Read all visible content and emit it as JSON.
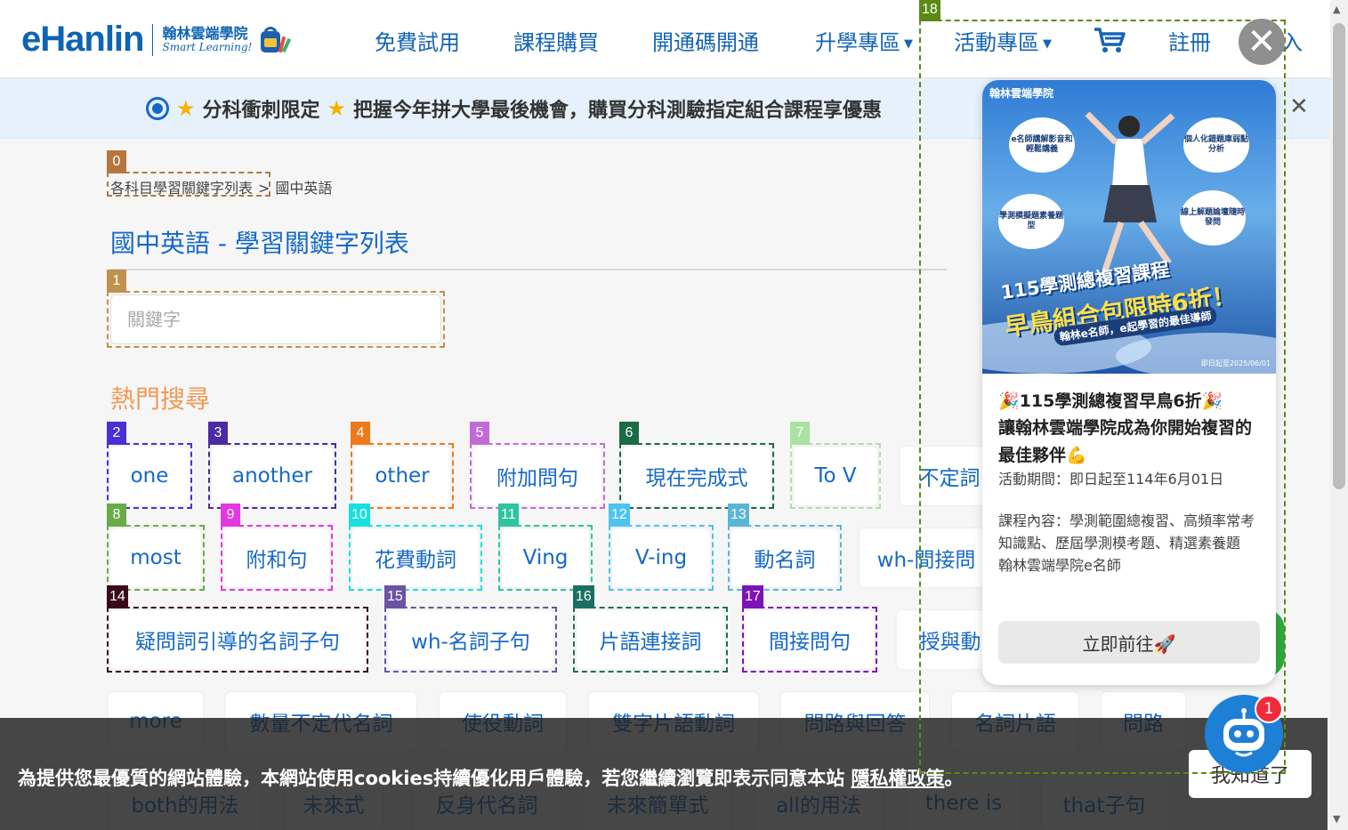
{
  "header": {
    "logo_text": "eHanlin",
    "logo_zh": "翰林雲端學院",
    "logo_en": "Smart Learning!",
    "nav": [
      {
        "label": "免費試用",
        "dropdown": false
      },
      {
        "label": "課程購買",
        "dropdown": false
      },
      {
        "label": "開通碼開通",
        "dropdown": false
      },
      {
        "label": "升學專區",
        "dropdown": true
      },
      {
        "label": "活動專區",
        "dropdown": true
      },
      {
        "label": "註冊",
        "dropdown": false
      }
    ],
    "cart_icon": "shopping-cart-icon",
    "caret_glyph": "▼",
    "partial_label": "入"
  },
  "notice": {
    "text": "分科衝刺限定",
    "text2": "把握今年拼大學最後機會，購買分科測驗指定組合課程享優惠",
    "close_glyph": "✕"
  },
  "breadcrumb": {
    "parent": "各科目學習關鍵字列表",
    "separator": ">",
    "current": "國中英語"
  },
  "page_title": "國中英語 - 學習關鍵字列表",
  "search": {
    "placeholder": "關鍵字",
    "value": ""
  },
  "section_title": "熱門搜尋",
  "chips": [
    {
      "label": "one",
      "marker": "2"
    },
    {
      "label": "another",
      "marker": "3"
    },
    {
      "label": "other",
      "marker": "4"
    },
    {
      "label": "附加問句",
      "marker": "5"
    },
    {
      "label": "現在完成式",
      "marker": "6"
    },
    {
      "label": "To V",
      "marker": "7"
    },
    {
      "label": "不定詞",
      "marker": ""
    },
    {
      "label": "most",
      "marker": "8"
    },
    {
      "label": "附和句",
      "marker": "9"
    },
    {
      "label": "花費動詞",
      "marker": "10"
    },
    {
      "label": "Ving",
      "marker": "11"
    },
    {
      "label": "V-ing",
      "marker": "12"
    },
    {
      "label": "動名詞",
      "marker": "13"
    },
    {
      "label": "wh-間接問",
      "marker": ""
    },
    {
      "label": "疑問詞引導的名詞子句",
      "marker": "14"
    },
    {
      "label": "wh-名詞子句",
      "marker": "15"
    },
    {
      "label": "片語連接詞",
      "marker": "16"
    },
    {
      "label": "間接問句",
      "marker": "17"
    },
    {
      "label": "授與動",
      "marker": ""
    },
    {
      "label": "more",
      "marker": ""
    },
    {
      "label": "數量不定代名詞",
      "marker": ""
    },
    {
      "label": "使役動詞",
      "marker": ""
    },
    {
      "label": "雙字片語動詞",
      "marker": ""
    },
    {
      "label": "問路與回答",
      "marker": ""
    },
    {
      "label": "名詞片語",
      "marker": ""
    },
    {
      "label": "問路",
      "marker": ""
    },
    {
      "label": "both的用法",
      "marker": ""
    },
    {
      "label": "未來式",
      "marker": ""
    },
    {
      "label": "反身代名詞",
      "marker": ""
    },
    {
      "label": "未來簡單式",
      "marker": ""
    },
    {
      "label": "all的用法",
      "marker": ""
    },
    {
      "label": "there is",
      "marker": ""
    },
    {
      "label": "that子句",
      "marker": ""
    }
  ],
  "markers": {
    "breadcrumb": "0",
    "search": "1",
    "popup": "18"
  },
  "marker_colors": {
    "0": "#b5773f",
    "1": "#c0924f",
    "2": "#4b2ed8",
    "3": "#4a2ba3",
    "4": "#ef7a1c",
    "5": "#c46ad6",
    "6": "#1a6b46",
    "7": "#a9e3a0",
    "8": "#6aab47",
    "9": "#e437e0",
    "10": "#18e0e0",
    "11": "#2ec4a0",
    "12": "#4cc3f0",
    "13": "#5ab6d9",
    "14": "#3a0a1c",
    "15": "#6a53a3",
    "16": "#1c6e63",
    "17": "#7c12b8",
    "18": "#5b8a14"
  },
  "cookie": {
    "text": "為提供您最優質的網站體驗，本網站使用cookies持續優化用戶體驗，若您繼續瀏覽即表示同意本站",
    "link": "隱私權政策",
    "suffix": "。",
    "button": "我知道了"
  },
  "popup": {
    "brand": "翰林雲端學院",
    "bubbles": [
      "e名師講解影音和輕鬆講義",
      "個人化錯題庫弱點分析",
      "學測模擬題素養題型",
      "線上解題論壇隨時發問"
    ],
    "promo_line1": "115學測總複習課程",
    "promo_line2": "早鳥組合包限時6折！",
    "promo_line3": "翰林e名師，e起學習的最佳導師",
    "promo_date": "即日起至2025/06/01",
    "heading": "🎉115學測總複習早鳥6折🎉",
    "subheading": "讓翰林雲端學院成為你開始複習的最佳夥伴💪",
    "period": "活動期間：即日起至114年6月01日",
    "content": "課程內容：學測範圍總複習、高頻率常考知識點、歷屆學測模考題、精選素養題",
    "teacher": "翰林雲端學院e名師",
    "button": "立即前往🚀",
    "close_glyph": "✕"
  },
  "chatbot": {
    "icon": "chatbot-robot-icon",
    "badge": "1"
  },
  "colors": {
    "brand_blue": "#0e63b2",
    "link_blue": "#1569c7",
    "section_orange": "#f09a55"
  }
}
